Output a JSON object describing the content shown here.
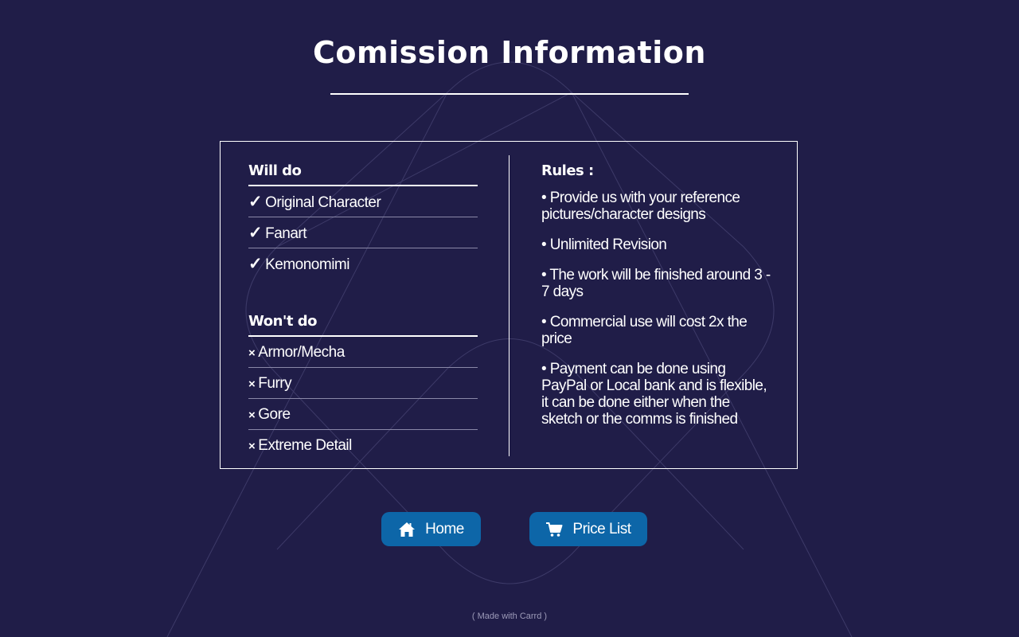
{
  "page": {
    "title": "Comission Information"
  },
  "will_do": {
    "heading": "Will do",
    "mark": "✓",
    "items": [
      "Original Character",
      "Fanart",
      "Kemonomimi"
    ]
  },
  "wont_do": {
    "heading": "Won't do",
    "mark": "×",
    "items": [
      "Armor/Mecha",
      "Furry",
      "Gore",
      "Extreme Detail"
    ]
  },
  "rules": {
    "heading": "Rules :",
    "items": [
      "• Provide us with your reference pictures/character designs",
      "• Unlimited Revision",
      "• The work will be finished around 3 - 7 days",
      "• Commercial use will cost 2x the price",
      "• Payment can be done using PayPal or Local bank and is flexible, it can be done either when the sketch or the comms is finished"
    ]
  },
  "buttons": {
    "home": {
      "label": "Home",
      "icon": "home-icon"
    },
    "price_list": {
      "label": "Price List",
      "icon": "cart-icon"
    }
  },
  "footer": {
    "text": "( Made with Carrd )"
  },
  "colors": {
    "background": "#201d48",
    "button": "#0d66a8",
    "text": "#ffffff"
  }
}
